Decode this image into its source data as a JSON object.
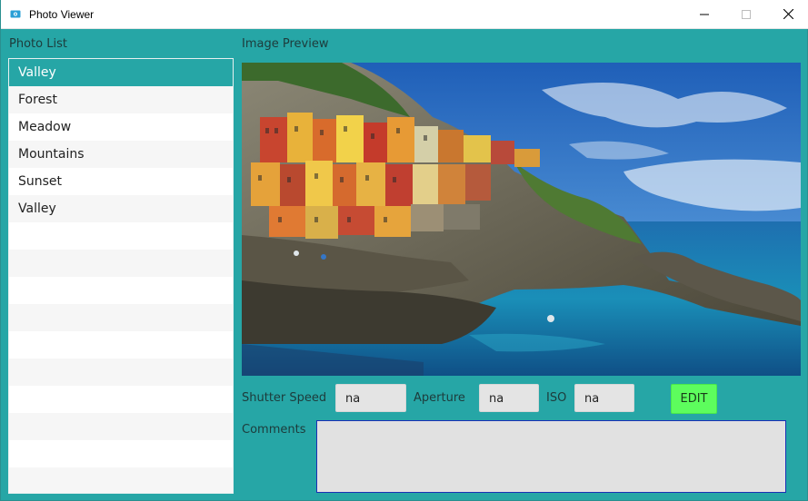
{
  "window": {
    "title": "Photo Viewer",
    "icon": "photo-viewer-app-icon"
  },
  "photo_list": {
    "label": "Photo List",
    "items": [
      "Valley",
      "Forest",
      "Meadow",
      "Mountains",
      "Sunset",
      "Valley"
    ],
    "selected_index": 0
  },
  "preview": {
    "label": "Image Preview"
  },
  "metadata": {
    "shutter_label": "Shutter Speed",
    "shutter_value": "na",
    "aperture_label": "Aperture",
    "aperture_value": "na",
    "iso_label": "ISO",
    "iso_value": "na",
    "edit_label": "EDIT"
  },
  "comments": {
    "label": "Comments",
    "value": ""
  },
  "colors": {
    "background": "#26a6a6",
    "selection": "#26a6a6",
    "edit_button": "#5dfd5d",
    "comments_border": "#1a2fb5"
  }
}
